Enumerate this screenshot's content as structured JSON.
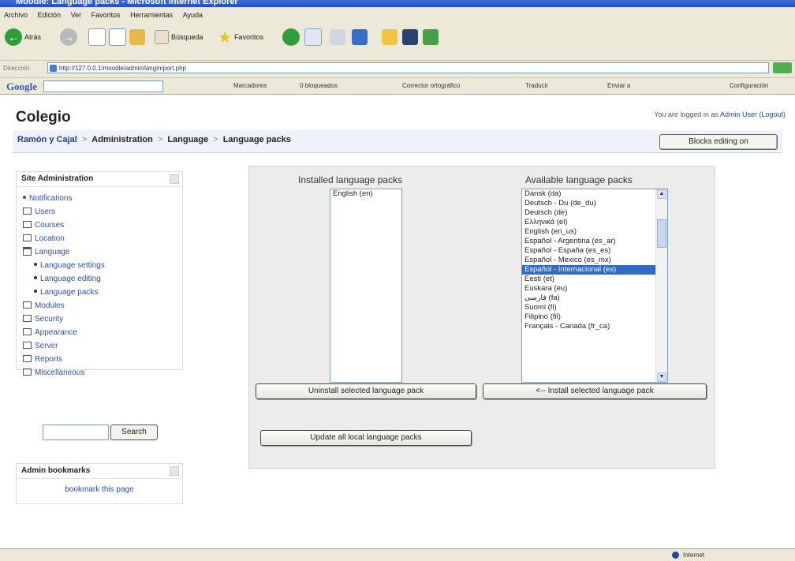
{
  "window": {
    "title": "Moodle: Language packs - Microsoft Internet Explorer"
  },
  "menu": [
    "Archivo",
    "Edición",
    "Ver",
    "Favoritos",
    "Herramientas",
    "Ayuda"
  ],
  "toolbar": {
    "back_label": "Atrás",
    "search_label": "Búsqueda",
    "favorites_label": "Favoritos"
  },
  "address": {
    "label": "Dirección",
    "url": "http://127.0.0.1/moodle/admin/langimport.php"
  },
  "googlebar": {
    "logo": "Google",
    "items": [
      "Marcadores",
      "0 bloqueados",
      "Corrector ortográfico",
      "Traducir",
      "Enviar a",
      "Configuración"
    ]
  },
  "site": {
    "title": "Colegio"
  },
  "login": {
    "prefix": "You are logged in as",
    "user": "Admin User",
    "logout": "(Logout)"
  },
  "breadcrumb": [
    "Ramón y Cajal",
    "Administration",
    "Language",
    "Language packs"
  ],
  "blocks_button": "Blocks editing on",
  "admin_block": {
    "title": "Site Administration",
    "items": [
      {
        "label": "Notifications",
        "type": "bullet"
      },
      {
        "label": "Users",
        "type": "folder"
      },
      {
        "label": "Courses",
        "type": "folder"
      },
      {
        "label": "Location",
        "type": "folder"
      },
      {
        "label": "Language",
        "type": "folder-open"
      },
      {
        "label": "Language settings",
        "type": "sub"
      },
      {
        "label": "Language editing",
        "type": "sub"
      },
      {
        "label": "Language packs",
        "type": "sub"
      },
      {
        "label": "Modules",
        "type": "folder"
      },
      {
        "label": "Security",
        "type": "folder"
      },
      {
        "label": "Appearance",
        "type": "folder"
      },
      {
        "label": "Server",
        "type": "folder"
      },
      {
        "label": "Reports",
        "type": "folder"
      },
      {
        "label": "Miscellaneous",
        "type": "folder"
      }
    ],
    "search_button": "Search"
  },
  "bookmarks_block": {
    "title": "Admin bookmarks",
    "link": "bookmark this page"
  },
  "lang_panel": {
    "installed_label": "Installed language packs",
    "available_label": "Available language packs",
    "installed": [
      "English (en)"
    ],
    "available": [
      "Dansk (da)",
      "Deutsch - Du (de_du)",
      "Deutsch (de)",
      "Ελληνικά (el)",
      "English (en_us)",
      "Español - Argentina (es_ar)",
      "Español - España (es_es)",
      "Español - Mexico (es_mx)",
      "Español - Internacional (es)",
      "Eesti (et)",
      "Euskara (eu)",
      "فارسی (fa)",
      "Suomi (fi)",
      "Filipino (fil)",
      "Français - Canada (fr_ca)"
    ],
    "selected_available": "Español - Internacional (es)",
    "uninstall_button": "Uninstall selected language pack",
    "install_button": "<-- Install selected language pack",
    "update_button": "Update all local language packs"
  },
  "status": {
    "zone": "Internet"
  }
}
